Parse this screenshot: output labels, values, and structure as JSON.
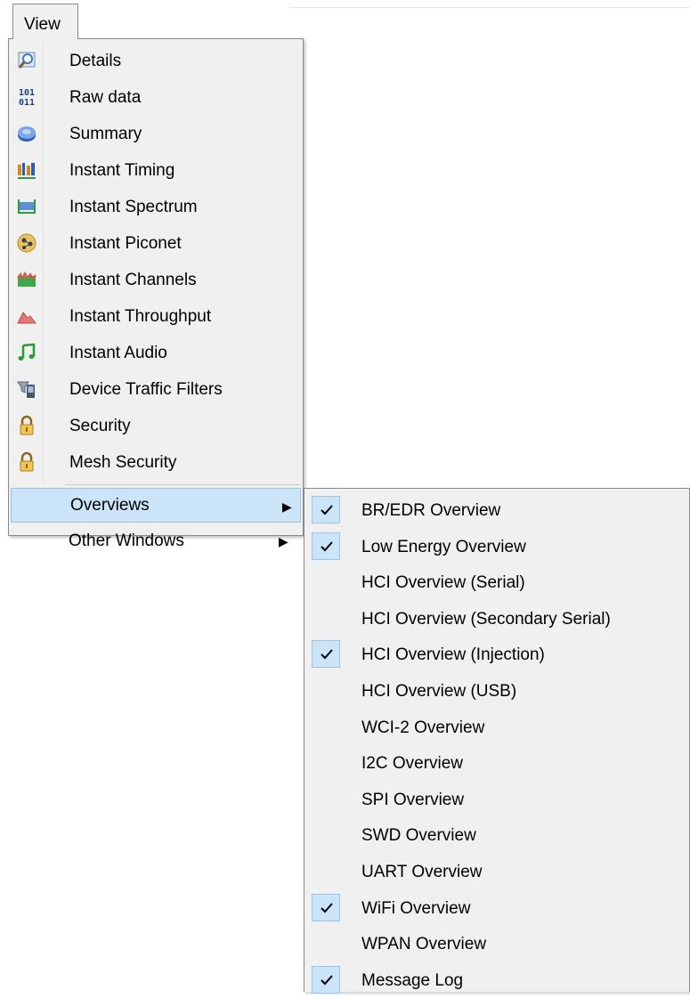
{
  "menubar": {
    "view_label": "View"
  },
  "view_menu": {
    "items": [
      {
        "label": "Details",
        "icon": "magnifier-icon"
      },
      {
        "label": "Raw data",
        "icon": "binary-101-011-icon"
      },
      {
        "label": "Summary",
        "icon": "disk-icon"
      },
      {
        "label": "Instant Timing",
        "icon": "timing-bars-icon"
      },
      {
        "label": "Instant Spectrum",
        "icon": "spectrum-icon"
      },
      {
        "label": "Instant Piconet",
        "icon": "piconet-icon"
      },
      {
        "label": "Instant Channels",
        "icon": "channels-icon"
      },
      {
        "label": "Instant Throughput",
        "icon": "throughput-icon"
      },
      {
        "label": "Instant Audio",
        "icon": "music-note-icon"
      },
      {
        "label": "Device Traffic Filters",
        "icon": "device-filter-icon"
      },
      {
        "label": "Security",
        "icon": "padlock-icon"
      },
      {
        "label": "Mesh Security",
        "icon": "padlock-icon"
      }
    ],
    "submenus": [
      {
        "label": "Overviews",
        "highlighted": true
      },
      {
        "label": "Other Windows",
        "highlighted": false
      }
    ]
  },
  "overviews_menu": {
    "items": [
      {
        "label": "BR/EDR Overview",
        "checked": true
      },
      {
        "label": "Low Energy Overview",
        "checked": true
      },
      {
        "label": "HCI Overview (Serial)",
        "checked": false
      },
      {
        "label": "HCI Overview (Secondary Serial)",
        "checked": false
      },
      {
        "label": "HCI Overview (Injection)",
        "checked": true
      },
      {
        "label": "HCI Overview (USB)",
        "checked": false
      },
      {
        "label": "WCI-2 Overview",
        "checked": false
      },
      {
        "label": "I2C Overview",
        "checked": false
      },
      {
        "label": "SPI Overview",
        "checked": false
      },
      {
        "label": "SWD Overview",
        "checked": false
      },
      {
        "label": "UART Overview",
        "checked": false
      },
      {
        "label": "WiFi Overview",
        "checked": true
      },
      {
        "label": "WPAN Overview",
        "checked": false
      },
      {
        "label": "Message Log",
        "checked": true
      }
    ]
  },
  "colors": {
    "highlight": "#cce4f7",
    "highlight_border": "#9cc3e6",
    "menu_bg": "#f0f0f0"
  }
}
